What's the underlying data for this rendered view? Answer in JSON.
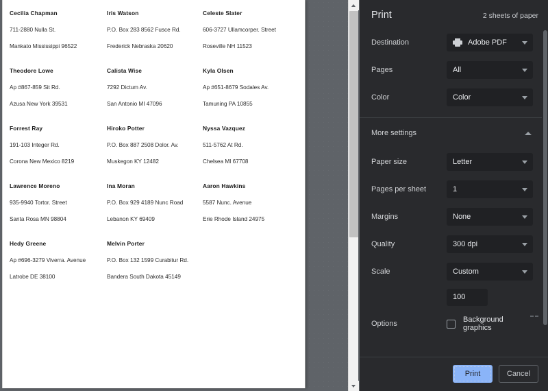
{
  "preview": {
    "addresses": [
      {
        "name": "Cecilia Chapman",
        "line1": "711-2880 Nulla St.",
        "line2": "Mankato Mississippi 96522"
      },
      {
        "name": "Iris Watson",
        "line1": "P.O. Box 283 8562 Fusce Rd.",
        "line2": "Frederick Nebraska 20620"
      },
      {
        "name": "Celeste Slater",
        "line1": "606-3727 Ullamcorper. Street",
        "line2": "Roseville NH 11523"
      },
      {
        "name": "Theodore Lowe",
        "line1": "Ap #867-859 Sit Rd.",
        "line2": "Azusa New York 39531"
      },
      {
        "name": "Calista Wise",
        "line1": "7292 Dictum Av.",
        "line2": "San Antonio MI 47096"
      },
      {
        "name": "Kyla Olsen",
        "line1": "Ap #651-8679 Sodales Av.",
        "line2": "Tamuning PA 10855"
      },
      {
        "name": "Forrest Ray",
        "line1": "191-103 Integer Rd.",
        "line2": "Corona New Mexico 8219"
      },
      {
        "name": "Hiroko Potter",
        "line1": "P.O. Box 887 2508 Dolor. Av.",
        "line2": "Muskegon KY 12482"
      },
      {
        "name": "Nyssa Vazquez",
        "line1": "511-5762 At Rd.",
        "line2": "Chelsea MI 67708"
      },
      {
        "name": "Lawrence Moreno",
        "line1": "935-9940 Tortor. Street",
        "line2": "Santa Rosa MN 98804"
      },
      {
        "name": "Ina Moran",
        "line1": "P.O. Box 929 4189 Nunc Road",
        "line2": "Lebanon KY 69409"
      },
      {
        "name": "Aaron Hawkins",
        "line1": "5587 Nunc. Avenue",
        "line2": "Erie Rhode Island 24975"
      },
      {
        "name": "Hedy Greene",
        "line1": "Ap #696-3279 Viverra. Avenue",
        "line2": "Latrobe DE 38100"
      },
      {
        "name": "Melvin Porter",
        "line1": "P.O. Box 132 1599 Curabitur Rd.",
        "line2": "Bandera South Dakota 45149"
      }
    ]
  },
  "dialog": {
    "title": "Print",
    "sheets_summary": "2 sheets of paper",
    "settings": [
      {
        "label": "Destination",
        "value": "Adobe PDF",
        "icon": "printer-icon",
        "key": "destination"
      },
      {
        "label": "Pages",
        "value": "All",
        "key": "pages"
      },
      {
        "label": "Color",
        "value": "Color",
        "key": "color"
      }
    ],
    "more_settings": {
      "label": "More settings",
      "expanded": true,
      "chevron": "chevron-up-icon",
      "settings": [
        {
          "label": "Paper size",
          "value": "Letter",
          "key": "paper-size"
        },
        {
          "label": "Pages per sheet",
          "value": "1",
          "key": "pages-per-sheet"
        },
        {
          "label": "Margins",
          "value": "None",
          "key": "margins"
        },
        {
          "label": "Quality",
          "value": "300 dpi",
          "key": "quality"
        },
        {
          "label": "Scale",
          "value": "Custom",
          "key": "scale"
        }
      ],
      "scale_value": "100",
      "options_label": "Options",
      "background_graphics_label": "Background graphics",
      "background_graphics_checked": false
    },
    "footer": {
      "print_label": "Print",
      "cancel_label": "Cancel"
    },
    "colors": {
      "panel_bg": "#292a2d",
      "field_bg": "#202124",
      "primary_button": "#8ab4f8",
      "text": "#e8eaed"
    }
  }
}
